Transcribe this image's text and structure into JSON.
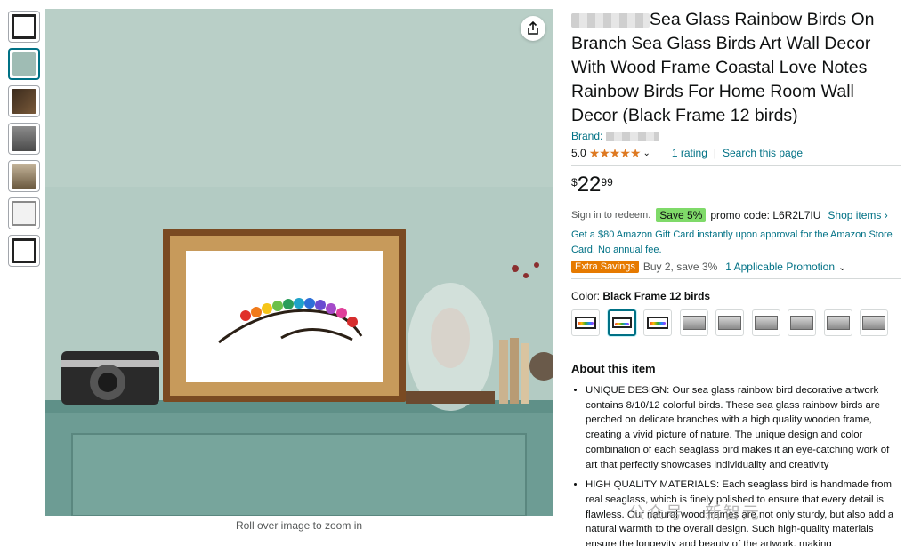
{
  "thumbnails": [
    {
      "name": "thumb-1",
      "style": "frame"
    },
    {
      "name": "thumb-2",
      "style": "wall",
      "selected": true
    },
    {
      "name": "thumb-3",
      "style": "dark"
    },
    {
      "name": "thumb-4",
      "style": "gray"
    },
    {
      "name": "thumb-5",
      "style": "wood"
    },
    {
      "name": "thumb-6",
      "style": "white"
    },
    {
      "name": "thumb-7",
      "style": "frame"
    }
  ],
  "main_image": {
    "zoom_hint": "Roll over image to zoom in",
    "share_icon": "share-icon"
  },
  "product": {
    "title": "Sea Glass Rainbow Birds On Branch Sea Glass Birds Art Wall Decor With Wood Frame Coastal Love Notes Rainbow Birds For Home Room Wall Decor (Black Frame 12 birds)",
    "brand_label": "Brand:",
    "rating_value": "5.0",
    "stars": "★★★★★",
    "rating_count": "1 rating",
    "search_page": "Search this page",
    "rating_separator": "|"
  },
  "price": {
    "symbol": "$",
    "whole": "22",
    "fraction": "99"
  },
  "promo": {
    "redeem_text": "Sign in to redeem.",
    "save_badge": "Save 5%",
    "promo_code": "promo code: L6R2L7IU",
    "shop_items": "Shop items ›"
  },
  "gift_card": {
    "text": "Get a $80 Amazon Gift Card instantly upon approval for the Amazon Store Card. No annual fee."
  },
  "extra_savings": {
    "badge": "Extra Savings",
    "buy_text": "Buy 2, save 3%",
    "applicable": "1 Applicable Promotion"
  },
  "color": {
    "label": "Color:",
    "selected": "Black Frame 12 birds"
  },
  "swatches": [
    {
      "style": "frame"
    },
    {
      "style": "frame",
      "selected": true
    },
    {
      "style": "frame"
    },
    {
      "style": "gray"
    },
    {
      "style": "gray"
    },
    {
      "style": "gray"
    },
    {
      "style": "gray"
    },
    {
      "style": "gray"
    },
    {
      "style": "gray"
    }
  ],
  "about": {
    "title": "About this item",
    "bullets": [
      "UNIQUE DESIGN: Our sea glass rainbow bird decorative artwork contains 8/10/12 colorful birds. These sea glass rainbow birds are perched on delicate branches with a high quality wooden frame, creating a vivid picture of nature. The unique design and color combination of each seaglass bird makes it an eye-catching work of art that perfectly showcases individuality and creativity",
      "HIGH QUALITY MATERIALS: Each seaglass bird is handmade from real seaglass, which is finely polished to ensure that every detail is flawless. Our natural wood frames are not only sturdy, but also add a natural warmth to the overall design. Such high-quality materials ensure the longevity and beauty of the artwork, making"
    ]
  },
  "watermark": "公众号 · 新智元"
}
